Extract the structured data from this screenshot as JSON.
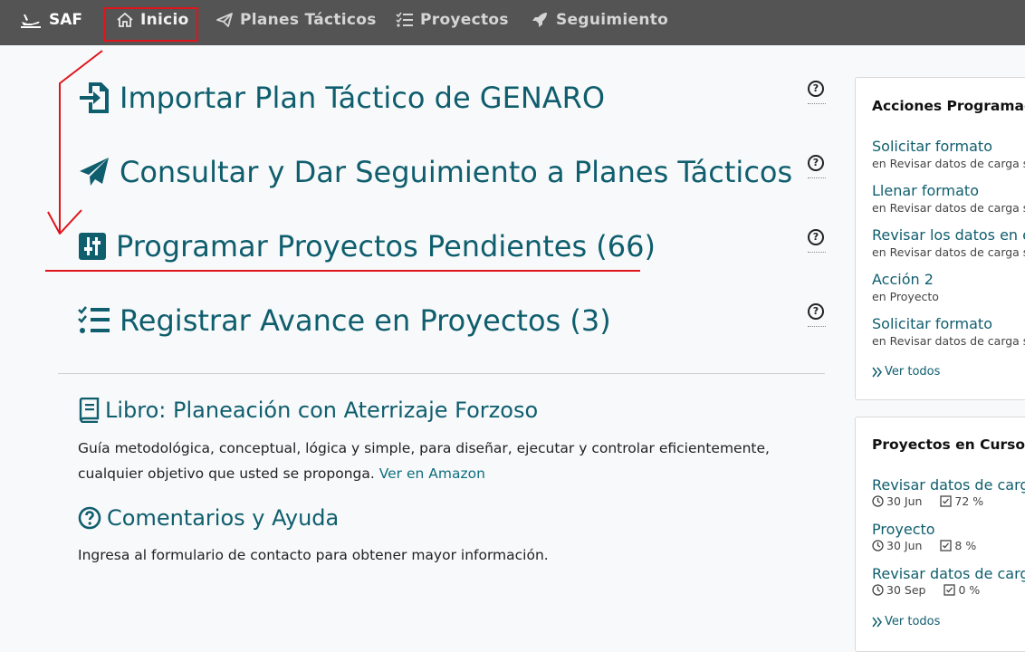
{
  "navbar": {
    "brand": "SAF",
    "items": [
      {
        "label": "Inicio",
        "icon": "home-icon"
      },
      {
        "label": "Planes Tácticos",
        "icon": "paper-plane-icon"
      },
      {
        "label": "Proyectos",
        "icon": "checklist-icon"
      },
      {
        "label": "Seguimiento",
        "icon": "rocket-icon"
      }
    ]
  },
  "main": {
    "actions": [
      {
        "label": "Importar Plan Táctico de GENARO",
        "icon": "file-import-icon"
      },
      {
        "label": "Consultar y Dar Seguimiento a Planes Tácticos",
        "icon": "paper-plane-icon"
      },
      {
        "label": "Programar Proyectos Pendientes (66)",
        "icon": "sliders-icon"
      },
      {
        "label": "Registrar Avance en Proyectos (3)",
        "icon": "tasks-icon"
      }
    ],
    "help_symbol": "?",
    "book": {
      "title": "Libro: Planeación con Aterrizaje Forzoso",
      "text": "Guía metodológica, conceptual, lógica y simple, para diseñar, ejecutar y controlar eficientemente, cualquier objetivo que usted se proponga.",
      "link": "Ver en Amazon"
    },
    "help": {
      "title": "Comentarios y Ayuda",
      "text": "Ingresa al formulario de contacto para obtener mayor información."
    }
  },
  "scheduled": {
    "title": "Acciones Programadas",
    "items": [
      {
        "label": "Solicitar formato",
        "sub": "en Revisar datos de carga sal"
      },
      {
        "label": "Llenar formato",
        "sub": "en Revisar datos de carga sal"
      },
      {
        "label": "Revisar los datos en el",
        "sub": "en Revisar datos de carga sal"
      },
      {
        "label": "Acción 2",
        "sub": "en Proyecto"
      },
      {
        "label": "Solicitar formato",
        "sub": "en Revisar datos de carga sal"
      }
    ],
    "see_all": "Ver todos"
  },
  "projects": {
    "title": "Proyectos en Curso",
    "items": [
      {
        "label": "Revisar datos de carga",
        "date": "30 Jun",
        "progress_text": "72 %",
        "progress": 72
      },
      {
        "label": "Proyecto",
        "date": "30 Jun",
        "progress_text": "8 %",
        "progress": 8
      },
      {
        "label": "Revisar datos de carga",
        "date": "30 Sep",
        "progress_text": "0 %",
        "progress": 0
      }
    ],
    "see_all": "Ver todos"
  },
  "colors": {
    "navbar": "#545454",
    "accent": "#0f5e6e",
    "annotation": "#e0141b"
  }
}
